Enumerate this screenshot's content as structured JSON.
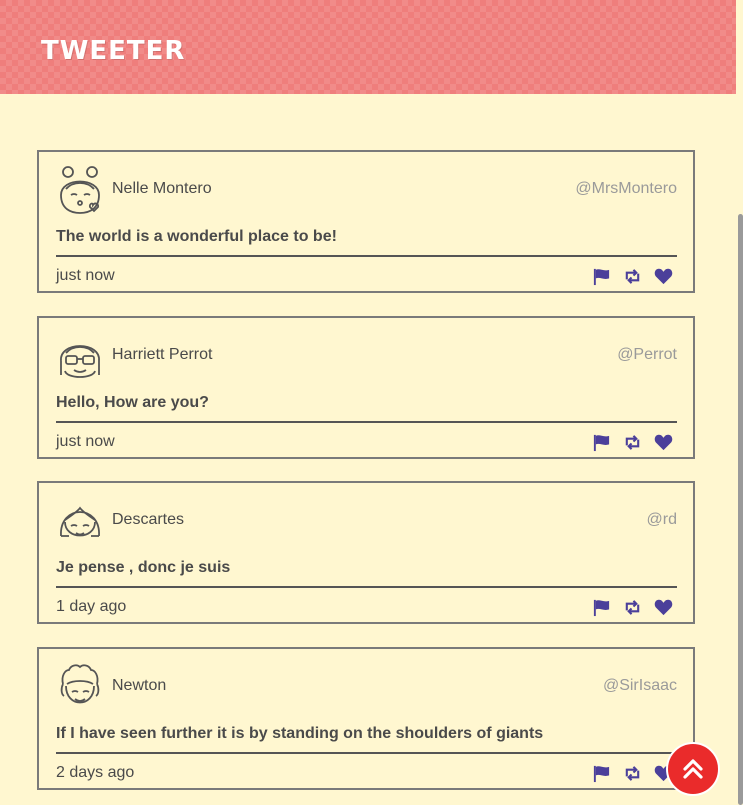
{
  "app": {
    "title": "TWEETER"
  },
  "colors": {
    "header": "#ef7e7c",
    "background": "#fff7d0",
    "accent": "#4b3f9a",
    "fab": "#ea2b2b"
  },
  "tweets": [
    {
      "name": "Nelle Montero",
      "handle": "@MrsMontero",
      "text": "The world is a wonderful place to be!",
      "time": "just now",
      "avatar_icon": "girl-buns-avatar-icon"
    },
    {
      "name": "Harriett Perrot",
      "handle": "@Perrot",
      "text": "Hello, How are you?",
      "time": "just now",
      "avatar_icon": "glasses-avatar-icon"
    },
    {
      "name": "Descartes",
      "handle": "@rd",
      "text": "Je pense , donc je suis",
      "time": "1 day ago",
      "avatar_icon": "bob-hair-avatar-icon"
    },
    {
      "name": "Newton",
      "handle": "@SirIsaac",
      "text": "If I have seen further it is by standing on the shoulders of giants",
      "time": "2 days ago",
      "avatar_icon": "curly-hair-avatar-icon"
    }
  ],
  "actions": {
    "flag_icon": "flag-icon",
    "retweet_icon": "retweet-icon",
    "like_icon": "heart-icon"
  },
  "fab": {
    "icon": "double-chevron-up-icon"
  }
}
